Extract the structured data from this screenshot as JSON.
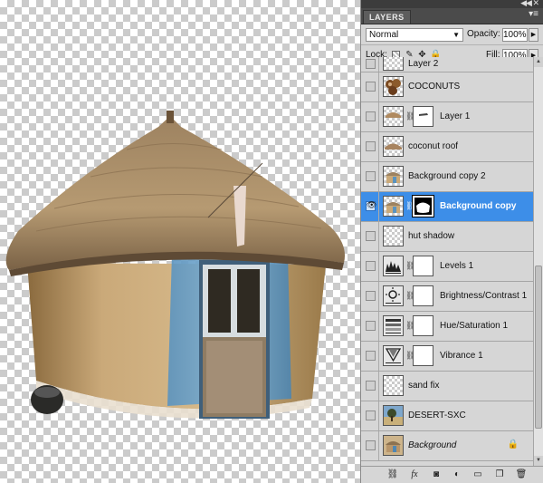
{
  "panel": {
    "tab_label": "LAYERS",
    "blend_mode": "Normal",
    "opacity_label": "Opacity:",
    "opacity_value": "100%",
    "lock_label": "Lock:",
    "fill_label": "Fill:",
    "fill_value": "100%"
  },
  "layers": [
    {
      "name": "Layer 2",
      "visible": false
    },
    {
      "name": "COCONUTS",
      "visible": false
    },
    {
      "name": "Layer 1",
      "visible": false
    },
    {
      "name": "coconut roof",
      "visible": false
    },
    {
      "name": "Background copy 2",
      "visible": false
    },
    {
      "name": "Background copy",
      "visible": true,
      "selected": true
    },
    {
      "name": "hut shadow",
      "visible": false
    },
    {
      "name": "Levels 1",
      "visible": false
    },
    {
      "name": "Brightness/Contrast 1",
      "visible": false
    },
    {
      "name": "Hue/Saturation 1",
      "visible": false
    },
    {
      "name": "Vibrance 1",
      "visible": false
    },
    {
      "name": "sand fix",
      "visible": false
    },
    {
      "name": "DESERT-SXC",
      "visible": false
    },
    {
      "name": "Background",
      "visible": false,
      "locked": true
    }
  ],
  "icons": {
    "eye": "eye-icon",
    "chain": "link-icon",
    "lock": "lock-icon",
    "menu": "panel-menu-icon",
    "collapse": "collapse-icon"
  },
  "colors": {
    "selected_row": "#3d8ee8",
    "panel_bg": "#d6d6d6"
  }
}
